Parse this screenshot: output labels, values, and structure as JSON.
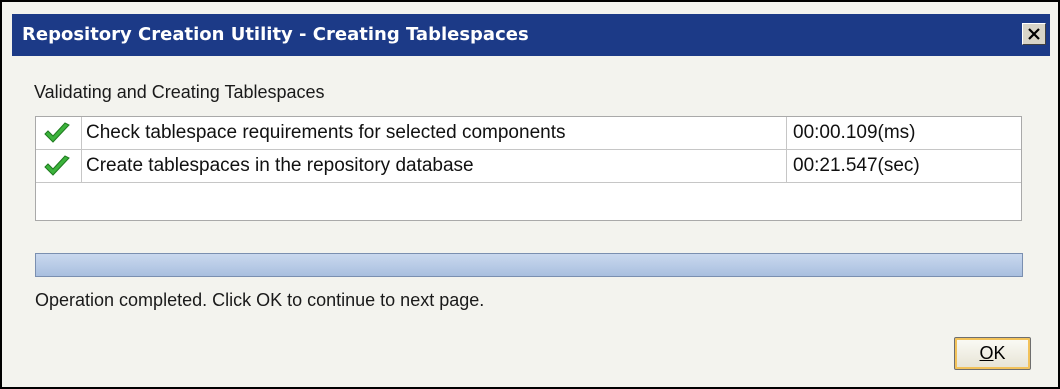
{
  "window": {
    "title": "Repository Creation Utility - Creating Tablespaces",
    "close_icon": "close-icon"
  },
  "heading": "Validating and Creating Tablespaces",
  "tasks": [
    {
      "status_icon": "green-check-icon",
      "description": "Check tablespace requirements for selected components",
      "time": "00:00.109(ms)"
    },
    {
      "status_icon": "green-check-icon",
      "description": "Create tablespaces in the repository database",
      "time": "00:21.547(sec)"
    }
  ],
  "progress": {
    "percent": 100
  },
  "status_text": "Operation completed. Click OK to continue to next page.",
  "ok_button": {
    "mnemonic": "O",
    "rest": "K"
  },
  "colors": {
    "titlebar": "#1c3a87",
    "dialog_bg": "#f3f3ee",
    "check": "#3cb33c",
    "progress_fill": "#a9bfdf"
  }
}
